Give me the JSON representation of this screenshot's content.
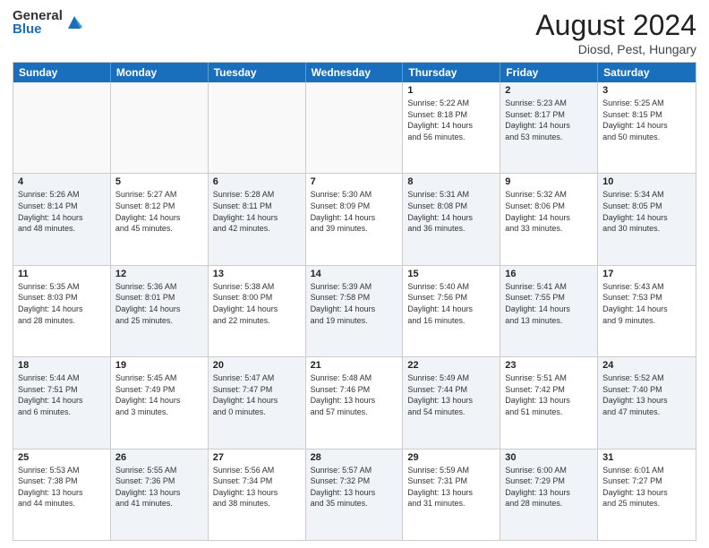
{
  "logo": {
    "general": "General",
    "blue": "Blue"
  },
  "title": "August 2024",
  "subtitle": "Diosd, Pest, Hungary",
  "days": [
    "Sunday",
    "Monday",
    "Tuesday",
    "Wednesday",
    "Thursday",
    "Friday",
    "Saturday"
  ],
  "rows": [
    [
      {
        "day": "",
        "empty": true
      },
      {
        "day": "",
        "empty": true
      },
      {
        "day": "",
        "empty": true
      },
      {
        "day": "",
        "empty": true
      },
      {
        "day": "1",
        "lines": [
          "Sunrise: 5:22 AM",
          "Sunset: 8:18 PM",
          "Daylight: 14 hours",
          "and 56 minutes."
        ]
      },
      {
        "day": "2",
        "lines": [
          "Sunrise: 5:23 AM",
          "Sunset: 8:17 PM",
          "Daylight: 14 hours",
          "and 53 minutes."
        ]
      },
      {
        "day": "3",
        "lines": [
          "Sunrise: 5:25 AM",
          "Sunset: 8:15 PM",
          "Daylight: 14 hours",
          "and 50 minutes."
        ]
      }
    ],
    [
      {
        "day": "4",
        "lines": [
          "Sunrise: 5:26 AM",
          "Sunset: 8:14 PM",
          "Daylight: 14 hours",
          "and 48 minutes."
        ]
      },
      {
        "day": "5",
        "lines": [
          "Sunrise: 5:27 AM",
          "Sunset: 8:12 PM",
          "Daylight: 14 hours",
          "and 45 minutes."
        ]
      },
      {
        "day": "6",
        "lines": [
          "Sunrise: 5:28 AM",
          "Sunset: 8:11 PM",
          "Daylight: 14 hours",
          "and 42 minutes."
        ]
      },
      {
        "day": "7",
        "lines": [
          "Sunrise: 5:30 AM",
          "Sunset: 8:09 PM",
          "Daylight: 14 hours",
          "and 39 minutes."
        ]
      },
      {
        "day": "8",
        "lines": [
          "Sunrise: 5:31 AM",
          "Sunset: 8:08 PM",
          "Daylight: 14 hours",
          "and 36 minutes."
        ]
      },
      {
        "day": "9",
        "lines": [
          "Sunrise: 5:32 AM",
          "Sunset: 8:06 PM",
          "Daylight: 14 hours",
          "and 33 minutes."
        ]
      },
      {
        "day": "10",
        "lines": [
          "Sunrise: 5:34 AM",
          "Sunset: 8:05 PM",
          "Daylight: 14 hours",
          "and 30 minutes."
        ]
      }
    ],
    [
      {
        "day": "11",
        "lines": [
          "Sunrise: 5:35 AM",
          "Sunset: 8:03 PM",
          "Daylight: 14 hours",
          "and 28 minutes."
        ]
      },
      {
        "day": "12",
        "lines": [
          "Sunrise: 5:36 AM",
          "Sunset: 8:01 PM",
          "Daylight: 14 hours",
          "and 25 minutes."
        ]
      },
      {
        "day": "13",
        "lines": [
          "Sunrise: 5:38 AM",
          "Sunset: 8:00 PM",
          "Daylight: 14 hours",
          "and 22 minutes."
        ]
      },
      {
        "day": "14",
        "lines": [
          "Sunrise: 5:39 AM",
          "Sunset: 7:58 PM",
          "Daylight: 14 hours",
          "and 19 minutes."
        ]
      },
      {
        "day": "15",
        "lines": [
          "Sunrise: 5:40 AM",
          "Sunset: 7:56 PM",
          "Daylight: 14 hours",
          "and 16 minutes."
        ]
      },
      {
        "day": "16",
        "lines": [
          "Sunrise: 5:41 AM",
          "Sunset: 7:55 PM",
          "Daylight: 14 hours",
          "and 13 minutes."
        ]
      },
      {
        "day": "17",
        "lines": [
          "Sunrise: 5:43 AM",
          "Sunset: 7:53 PM",
          "Daylight: 14 hours",
          "and 9 minutes."
        ]
      }
    ],
    [
      {
        "day": "18",
        "lines": [
          "Sunrise: 5:44 AM",
          "Sunset: 7:51 PM",
          "Daylight: 14 hours",
          "and 6 minutes."
        ]
      },
      {
        "day": "19",
        "lines": [
          "Sunrise: 5:45 AM",
          "Sunset: 7:49 PM",
          "Daylight: 14 hours",
          "and 3 minutes."
        ]
      },
      {
        "day": "20",
        "lines": [
          "Sunrise: 5:47 AM",
          "Sunset: 7:47 PM",
          "Daylight: 14 hours",
          "and 0 minutes."
        ]
      },
      {
        "day": "21",
        "lines": [
          "Sunrise: 5:48 AM",
          "Sunset: 7:46 PM",
          "Daylight: 13 hours",
          "and 57 minutes."
        ]
      },
      {
        "day": "22",
        "lines": [
          "Sunrise: 5:49 AM",
          "Sunset: 7:44 PM",
          "Daylight: 13 hours",
          "and 54 minutes."
        ]
      },
      {
        "day": "23",
        "lines": [
          "Sunrise: 5:51 AM",
          "Sunset: 7:42 PM",
          "Daylight: 13 hours",
          "and 51 minutes."
        ]
      },
      {
        "day": "24",
        "lines": [
          "Sunrise: 5:52 AM",
          "Sunset: 7:40 PM",
          "Daylight: 13 hours",
          "and 47 minutes."
        ]
      }
    ],
    [
      {
        "day": "25",
        "lines": [
          "Sunrise: 5:53 AM",
          "Sunset: 7:38 PM",
          "Daylight: 13 hours",
          "and 44 minutes."
        ]
      },
      {
        "day": "26",
        "lines": [
          "Sunrise: 5:55 AM",
          "Sunset: 7:36 PM",
          "Daylight: 13 hours",
          "and 41 minutes."
        ]
      },
      {
        "day": "27",
        "lines": [
          "Sunrise: 5:56 AM",
          "Sunset: 7:34 PM",
          "Daylight: 13 hours",
          "and 38 minutes."
        ]
      },
      {
        "day": "28",
        "lines": [
          "Sunrise: 5:57 AM",
          "Sunset: 7:32 PM",
          "Daylight: 13 hours",
          "and 35 minutes."
        ]
      },
      {
        "day": "29",
        "lines": [
          "Sunrise: 5:59 AM",
          "Sunset: 7:31 PM",
          "Daylight: 13 hours",
          "and 31 minutes."
        ]
      },
      {
        "day": "30",
        "lines": [
          "Sunrise: 6:00 AM",
          "Sunset: 7:29 PM",
          "Daylight: 13 hours",
          "and 28 minutes."
        ]
      },
      {
        "day": "31",
        "lines": [
          "Sunrise: 6:01 AM",
          "Sunset: 7:27 PM",
          "Daylight: 13 hours",
          "and 25 minutes."
        ]
      }
    ]
  ]
}
